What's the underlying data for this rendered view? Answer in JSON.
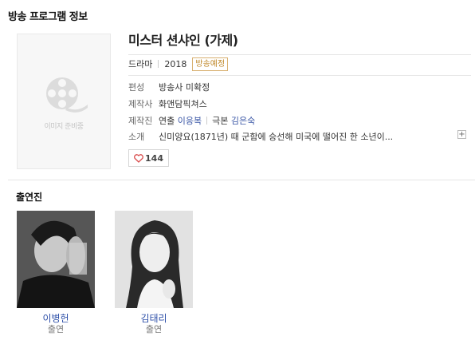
{
  "section_title": "방송 프로그램 정보",
  "poster": {
    "placeholder_label": "이미지 준비중",
    "icon": "film-reel-icon"
  },
  "program": {
    "title": "미스터 션샤인 (가제)",
    "genre": "드라마",
    "year": "2018",
    "status_badge": "방송예정",
    "rows": {
      "channel": {
        "label": "편성",
        "value": "방송사 미확정"
      },
      "producer": {
        "label": "제작사",
        "value": "화앤담픽쳐스"
      },
      "staff": {
        "label": "제작진",
        "director_label": "연출",
        "director": "이응복",
        "writer_label": "극본",
        "writer": "김은숙"
      },
      "intro": {
        "label": "소개",
        "value": "신미양요(1871년) 때 군함에 승선해 미국에 떨어진 한 소년이..."
      }
    },
    "more_button": "+",
    "likes": {
      "icon": "heart-icon",
      "count": "144"
    }
  },
  "cast_section": {
    "title": "출연진",
    "members": [
      {
        "name": "이병헌",
        "role": "출연"
      },
      {
        "name": "김태리",
        "role": "출연"
      }
    ]
  },
  "colors": {
    "link": "#3b57a6",
    "badge": "#c18a2c",
    "heart": "#d94a4a"
  }
}
